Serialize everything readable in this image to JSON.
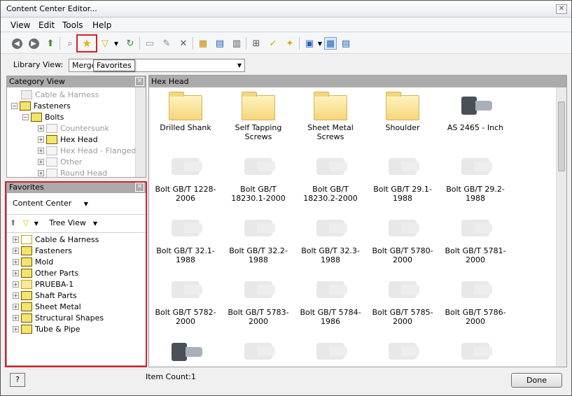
{
  "window": {
    "title": "Content Center Editor...",
    "close_glyph": "✕"
  },
  "menu": [
    "View",
    "Edit",
    "Tools",
    "Help"
  ],
  "toolbar": {
    "tooltip": "Favorites",
    "icons": [
      "back-icon",
      "forward-icon",
      "up-folder-icon",
      "find-icon",
      "favorites-icon",
      "filter-icon",
      "refresh-icon",
      "folder-icon",
      "edit-icon",
      "delete-icon",
      "table-edit-icon",
      "family-properties-icon",
      "table-view-icon",
      "category-icon",
      "publish-icon",
      "wizard-icon",
      "view-options-icon",
      "large-icons-view-icon",
      "small-icons-view-icon"
    ]
  },
  "library_view": {
    "label": "Library View:",
    "value": "Merge"
  },
  "category_view": {
    "title": "Category View",
    "items": [
      {
        "label": "Cable & Harness",
        "muted": true
      },
      {
        "label": "Fasteners",
        "muted": false
      },
      {
        "label": "Bolts",
        "muted": false
      },
      {
        "label": "Countersunk",
        "muted": true
      },
      {
        "label": "Hex Head",
        "muted": false
      },
      {
        "label": "Hex Head - Flanged",
        "muted": true
      },
      {
        "label": "Other",
        "muted": true
      },
      {
        "label": "Round Head",
        "muted": true
      }
    ]
  },
  "favorites": {
    "title": "Favorites",
    "source": "Content Center",
    "view_mode": "Tree View",
    "items": [
      "Cable & Harness",
      "Fasteners",
      "Mold",
      "Other Parts",
      "PRUEBA-1",
      "Shaft Parts",
      "Sheet Metal",
      "Structural Shapes",
      "Tube & Pipe"
    ]
  },
  "main": {
    "title": "Hex Head",
    "items": [
      {
        "label": "Drilled Shank",
        "kind": "folder"
      },
      {
        "label": "Self Tapping Screws",
        "kind": "folder"
      },
      {
        "label": "Sheet Metal Screws",
        "kind": "folder"
      },
      {
        "label": "Shoulder",
        "kind": "folder"
      },
      {
        "label": "AS 2465 - Inch",
        "kind": "dark"
      },
      {
        "label": "Bolt GB/T 1228-2006",
        "kind": "ghost"
      },
      {
        "label": "Bolt GB/T 18230.1-2000",
        "kind": "ghost"
      },
      {
        "label": "Bolt GB/T 18230.2-2000",
        "kind": "ghost"
      },
      {
        "label": "Bolt GB/T 29.1-1988",
        "kind": "ghost"
      },
      {
        "label": "Bolt GB/T 29.2-1988",
        "kind": "ghost"
      },
      {
        "label": "Bolt GB/T 32.1-1988",
        "kind": "ghost"
      },
      {
        "label": "Bolt GB/T 32.2-1988",
        "kind": "ghost"
      },
      {
        "label": "Bolt GB/T 32.3-1988",
        "kind": "ghost"
      },
      {
        "label": "Bolt GB/T 5780-2000",
        "kind": "ghost"
      },
      {
        "label": "Bolt GB/T 5781-2000",
        "kind": "ghost"
      },
      {
        "label": "Bolt GB/T 5782-2000",
        "kind": "ghost"
      },
      {
        "label": "Bolt GB/T 5783-2000",
        "kind": "ghost"
      },
      {
        "label": "Bolt GB/T 5784-1986",
        "kind": "ghost"
      },
      {
        "label": "Bolt GB/T 5785-2000",
        "kind": "ghost"
      },
      {
        "label": "Bolt GB/T 5786-2000",
        "kind": "ghost"
      },
      {
        "label": "",
        "kind": "dark"
      },
      {
        "label": "",
        "kind": "ghost"
      },
      {
        "label": "",
        "kind": "ghost"
      },
      {
        "label": "",
        "kind": "ghost"
      },
      {
        "label": "",
        "kind": "ghost"
      }
    ]
  },
  "status": {
    "item_count": "Item Count:1",
    "done_label": "Done",
    "help_glyph": "?"
  }
}
